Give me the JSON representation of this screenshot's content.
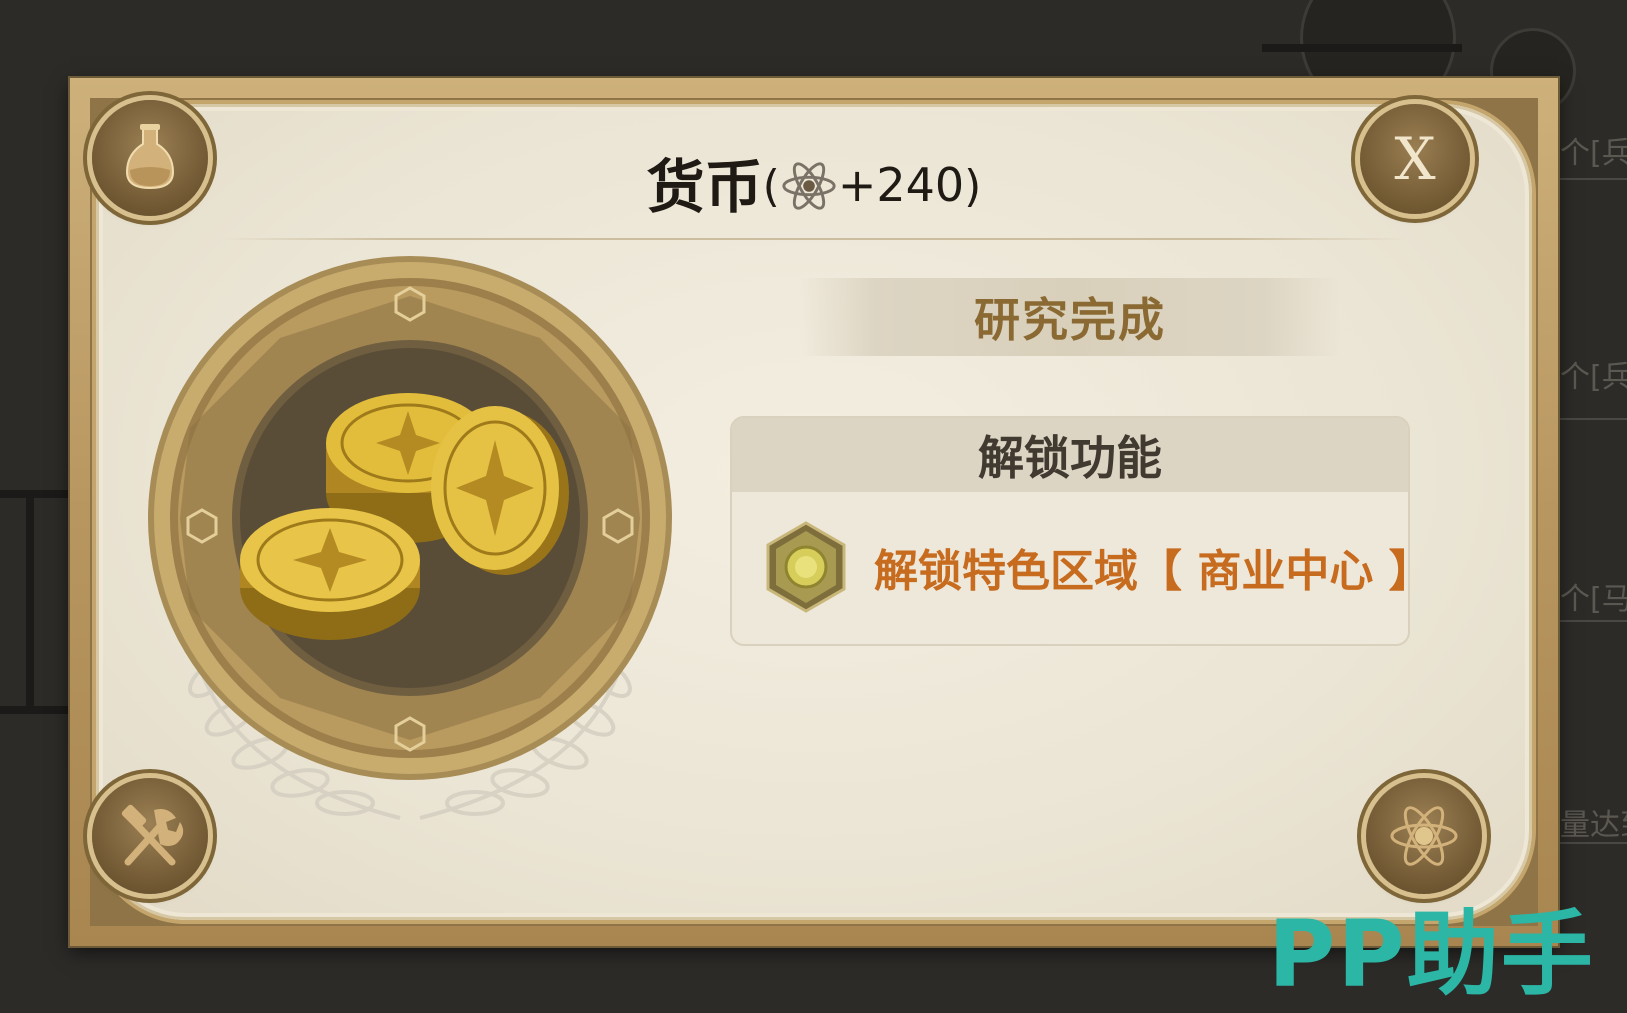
{
  "dialog": {
    "title": "货币",
    "title_paren_open": "(",
    "title_amount": "+240",
    "title_paren_close": ")",
    "close_label": "X",
    "research_status": "研究完成",
    "unlock_heading": "解锁功能",
    "unlock_item": "解锁特色区域【 商业中心 】"
  },
  "background": {
    "row_labels": [
      "个[兵",
      "个[兵",
      "个[马",
      "量达到"
    ]
  },
  "watermark": "PP助手",
  "colors": {
    "accent_orange": "#c76b1f",
    "research_gold": "#8a6a32",
    "frame_gold": "#c4a56c",
    "watermark_teal": "#2bb6a6"
  },
  "icons": {
    "corner_top_left": "flask-icon",
    "corner_bottom_left": "tools-icon",
    "corner_bottom_right": "atom-icon",
    "title_currency": "atom-icon",
    "unlock_item": "coin-hexagon-icon",
    "emblem": "gold-coins-icon"
  }
}
